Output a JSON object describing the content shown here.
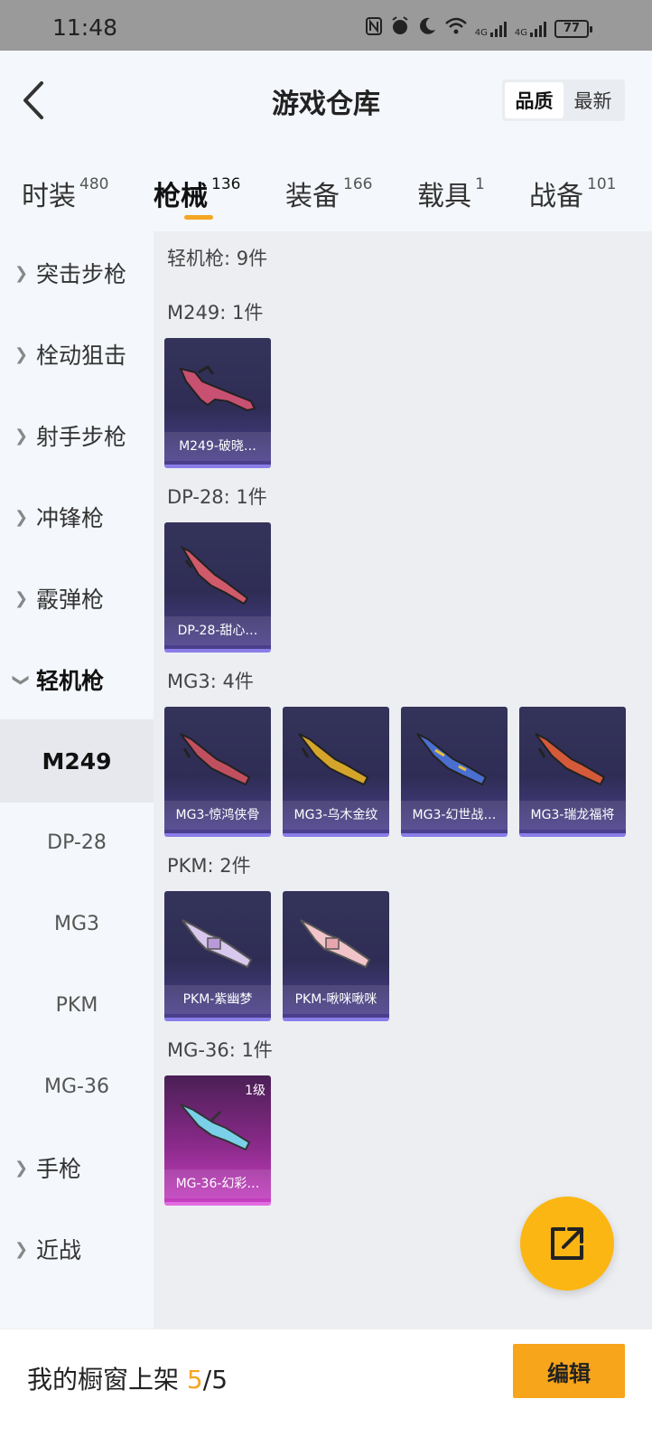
{
  "status_bar": {
    "time": "11:48",
    "battery": "77",
    "icons": [
      "nfc-icon",
      "alarm-icon",
      "moon-icon",
      "wifi-icon",
      "signal-4g-icon",
      "signal-4g-icon",
      "battery-icon"
    ],
    "net1": "4G",
    "net2": "4G"
  },
  "header": {
    "title": "游戏仓库",
    "sort_options": [
      "品质",
      "最新"
    ],
    "sort_selected": "品质"
  },
  "tabs": [
    {
      "label": "时装",
      "count": "480"
    },
    {
      "label": "枪械",
      "count": "136",
      "active": true
    },
    {
      "label": "装备",
      "count": "166"
    },
    {
      "label": "载具",
      "count": "1"
    },
    {
      "label": "战备",
      "count": "101"
    }
  ],
  "sidebar": {
    "categories": [
      {
        "label": "突击步枪"
      },
      {
        "label": "栓动狙击"
      },
      {
        "label": "射手步枪"
      },
      {
        "label": "冲锋枪"
      },
      {
        "label": "霰弹枪"
      },
      {
        "label": "轻机枪",
        "open": true
      }
    ],
    "subitems": [
      "M249",
      "DP-28",
      "MG3",
      "PKM",
      "MG-36"
    ],
    "sub_selected": "M249",
    "more_categories": [
      {
        "label": "手枪"
      },
      {
        "label": "近战"
      }
    ]
  },
  "content": {
    "section_title": "轻机枪: 9件",
    "groups": [
      {
        "title": "M249: 1件",
        "items": [
          {
            "name": "M249-破晓…",
            "color": "#c85070"
          }
        ]
      },
      {
        "title": "DP-28: 1件",
        "items": [
          {
            "name": "DP-28-甜心…",
            "color": "#d05a6a"
          }
        ]
      },
      {
        "title": "MG3: 4件",
        "items": [
          {
            "name": "MG3-惊鸿侠骨",
            "color": "#c05060"
          },
          {
            "name": "MG3-乌木金纹",
            "color": "#d4a52a"
          },
          {
            "name": "MG3-幻世战…",
            "color": "#4a6fd0"
          },
          {
            "name": "MG3-瑞龙福将",
            "color": "#d45a3a"
          }
        ]
      },
      {
        "title": "PKM: 2件",
        "items": [
          {
            "name": "PKM-紫幽梦",
            "color": "#d8c8ee"
          },
          {
            "name": "PKM-啾咪啾咪",
            "color": "#f0c4c8"
          }
        ]
      },
      {
        "title": "MG-36: 1件",
        "items": [
          {
            "name": "MG-36-幻彩…",
            "color": "#7ad0e8",
            "level": "1级",
            "pink": true
          }
        ]
      }
    ]
  },
  "bottom": {
    "label": "我的橱窗上架",
    "count": "5",
    "separator": "/",
    "total": "5",
    "edit_label": "编辑"
  },
  "colors": {
    "accent": "#f5a623",
    "fab": "#fbb614",
    "card_bg": "#2f2d55",
    "card_border": "#8a7de8",
    "card_pink": "#c43fc0"
  }
}
